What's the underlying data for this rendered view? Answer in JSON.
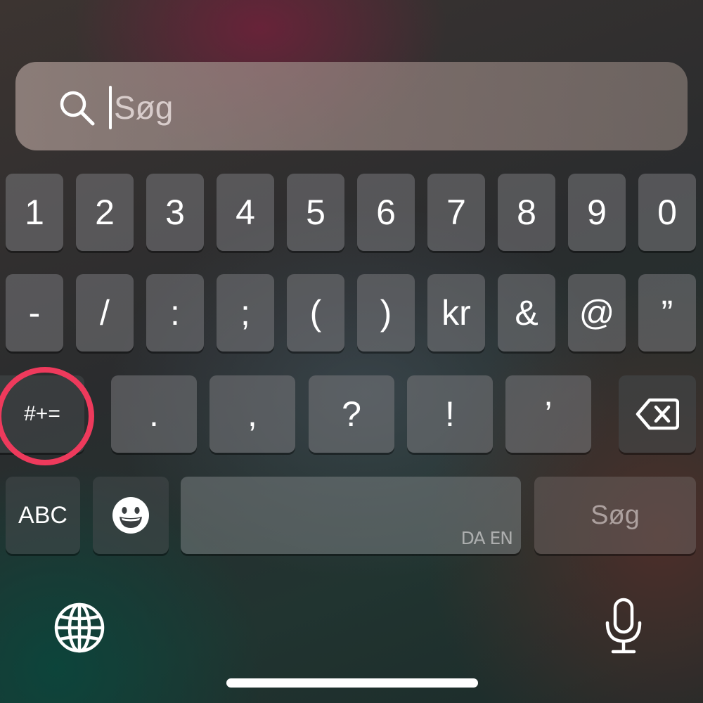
{
  "search": {
    "placeholder": "Søg",
    "icon": "search-icon"
  },
  "keyboard": {
    "number_row": [
      "1",
      "2",
      "3",
      "4",
      "5",
      "6",
      "7",
      "8",
      "9",
      "0"
    ],
    "symbol_row": [
      "-",
      "/",
      ":",
      ";",
      "(",
      ")",
      "kr",
      "&",
      "@",
      "”"
    ],
    "punct_row": [
      ".",
      ",",
      "?",
      "!",
      "’"
    ],
    "more_symbols_label": "#+=",
    "backspace_icon": "backspace-icon",
    "abc_label": "ABC",
    "emoji_icon": "emoji-icon",
    "space_languages": "DA EN",
    "return_label": "Søg",
    "globe_icon": "globe-icon",
    "mic_icon": "microphone-icon"
  },
  "colors": {
    "highlight_ring": "#ee3a5c",
    "key_text": "#ffffff"
  }
}
